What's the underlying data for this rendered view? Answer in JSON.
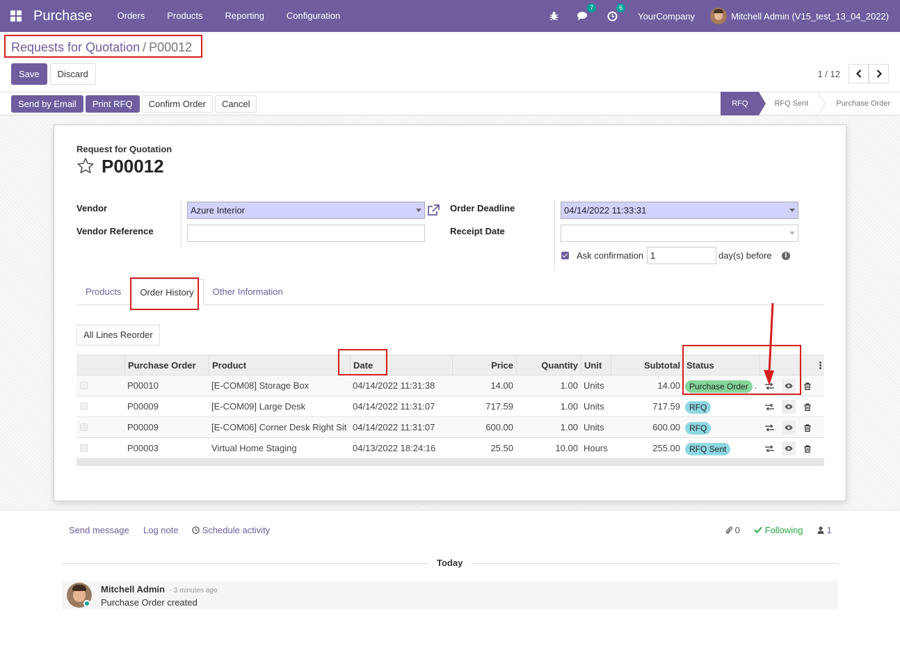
{
  "navbar": {
    "app_name": "Purchase",
    "menu": [
      "Orders",
      "Products",
      "Reporting",
      "Configuration"
    ],
    "messages_count": "7",
    "activities_count": "6",
    "company": "YourCompany",
    "user": "Mitchell Admin (V15_test_13_04_2022)"
  },
  "breadcrumb": {
    "parent": "Requests for Quotation",
    "separator": "/",
    "current": "P00012"
  },
  "buttons": {
    "save": "Save",
    "discard": "Discard",
    "send_email": "Send by Email",
    "print_rfq": "Print RFQ",
    "confirm": "Confirm Order",
    "cancel": "Cancel"
  },
  "pager": {
    "value": "1 / 12"
  },
  "stages": [
    "RFQ",
    "RFQ Sent",
    "Purchase Order"
  ],
  "form": {
    "doc_type": "Request for Quotation",
    "name": "P00012",
    "vendor_label": "Vendor",
    "vendor_value": "Azure Interior",
    "vendor_ref_label": "Vendor Reference",
    "vendor_ref_value": "",
    "deadline_label": "Order Deadline",
    "deadline_value": "04/14/2022 11:33:31",
    "receipt_label": "Receipt Date",
    "receipt_value": "",
    "ask_confirmation_label": "Ask confirmation",
    "ask_confirmation_days": "1",
    "days_before": "day(s) before"
  },
  "tabs": [
    "Products",
    "Order History",
    "Other Information"
  ],
  "reorder_button": "All Lines Reorder",
  "table": {
    "headers": [
      "Purchase Order",
      "Product",
      "Date",
      "Price",
      "Quantity",
      "Unit",
      "Subtotal",
      "Status"
    ],
    "rows": [
      {
        "po": "P00010",
        "product": "[E-COM08] Storage Box",
        "date": "04/14/2022 11:31:38",
        "price": "14.00",
        "qty": "1.00",
        "unit": "Units",
        "subtotal": "14.00",
        "status": "Purchase Order",
        "status_color": "green"
      },
      {
        "po": "P00009",
        "product": "[E-COM09] Large Desk",
        "date": "04/14/2022 11:31:07",
        "price": "717.59",
        "qty": "1.00",
        "unit": "Units",
        "subtotal": "717.59",
        "status": "RFQ",
        "status_color": "blue"
      },
      {
        "po": "P00009",
        "product": "[E-COM06] Corner Desk Right Sit",
        "date": "04/14/2022 11:31:07",
        "price": "600.00",
        "qty": "1.00",
        "unit": "Units",
        "subtotal": "600.00",
        "status": "RFQ",
        "status_color": "blue"
      },
      {
        "po": "P00003",
        "product": "Virtual Home Staging",
        "date": "04/13/2022 18:24:16",
        "price": "25.50",
        "qty": "10.00",
        "unit": "Hours",
        "subtotal": "255.00",
        "status": "RFQ Sent",
        "status_color": "blue"
      }
    ]
  },
  "chatter": {
    "send_message": "Send message",
    "log_note": "Log note",
    "schedule_activity": "Schedule activity",
    "attachments": "0",
    "following": "Following",
    "followers": "1",
    "today": "Today",
    "author": "Mitchell Admin",
    "time": "- 3 minutes ago",
    "body": "Purchase Order created"
  },
  "colors": {
    "brand": "#6f5d9e",
    "highlight": "#d71c1c",
    "status_green": "#86d69a",
    "status_blue": "#8fd7e3"
  }
}
